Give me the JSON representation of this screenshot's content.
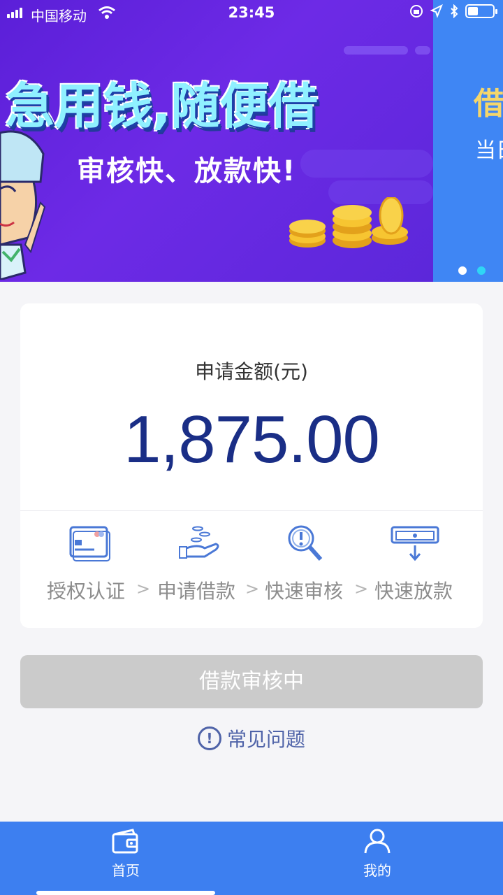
{
  "status_bar": {
    "carrier": "中国移动",
    "time": "23:45"
  },
  "banner": {
    "slide1_title": "急用钱,随便借",
    "slide1_subtitle": "审核快、放款快!",
    "slide2_title": "借",
    "slide2_subtitle": "当日",
    "active_dot": 1
  },
  "card": {
    "amount_label": "申请金额(元)",
    "amount": "1,875.00",
    "steps": [
      {
        "label": "授权认证",
        "icon": "id-card-icon"
      },
      {
        "label": "申请借款",
        "icon": "hand-coins-icon"
      },
      {
        "label": "快速审核",
        "icon": "magnifier-alert-icon"
      },
      {
        "label": "快速放款",
        "icon": "cash-out-icon"
      }
    ],
    "arrow": ">"
  },
  "button": {
    "label": "借款审核中"
  },
  "faq": {
    "icon": "!",
    "label": "常见问题"
  },
  "tabbar": {
    "tabs": [
      {
        "label": "首页",
        "icon": "wallet-icon"
      },
      {
        "label": "我的",
        "icon": "user-icon"
      }
    ]
  },
  "colors": {
    "banner_purple": "#6a28e0",
    "amount_blue": "#1a2e86",
    "tabbar_blue": "#3d7ff0",
    "disabled_button": "#cbcbcb",
    "faq_blue": "#4f63a8"
  }
}
